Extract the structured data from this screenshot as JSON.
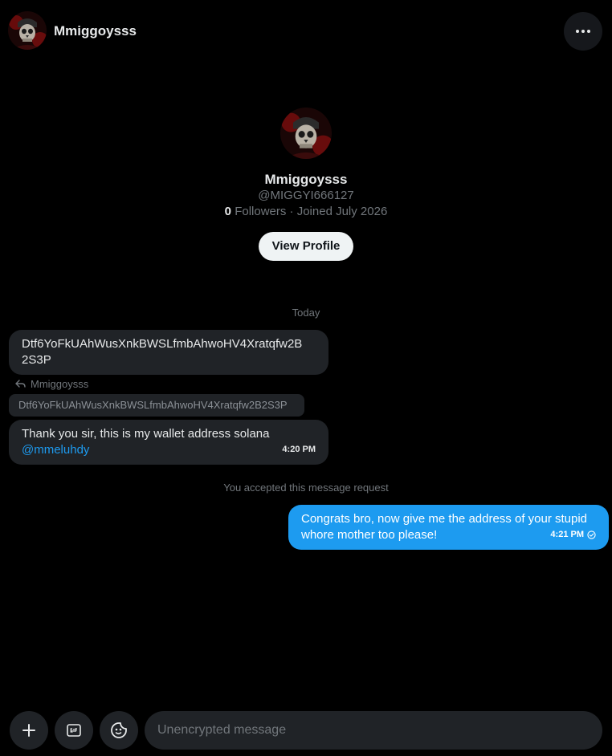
{
  "header": {
    "name": "Mmiggoysss",
    "avatar_icon": "skull-avatar-icon",
    "more_icon": "more-horizontal-icon"
  },
  "profile": {
    "name": "Mmiggoysss",
    "handle": "@MIGGYI666127",
    "followers_count": "0",
    "followers_label": "Followers",
    "meta_separator": " · ",
    "joined": "Joined July 2026",
    "view_profile_label": "View Profile"
  },
  "conversation": {
    "date_divider": "Today",
    "messages": [
      {
        "direction": "incoming",
        "text_line1": "Dtf6YoFkUAhWusXnkBWSLfmbAhwoHV4Xratqfw2B",
        "text_line2": "2S3P"
      },
      {
        "direction": "incoming",
        "reply_to_name": "Mmiggoysss",
        "quoted_text": "Dtf6YoFkUAhWusXnkBWSLfmbAhwoHV4Xratqfw2B2S3P",
        "text": "Thank you sir, this is my wallet address solana",
        "mention": "@mmeluhdy",
        "time": "4:20 PM"
      },
      {
        "direction": "outgoing",
        "text_line1": "Congrats bro, now give me the address of your stupid",
        "text_line2": "whore mother too please!",
        "time": "4:21 PM",
        "status_icon": "sent-check-icon"
      }
    ],
    "accepted_notice": "You accepted this message request"
  },
  "composer": {
    "placeholder": "Unencrypted message",
    "buttons": [
      "plus-icon",
      "gif-icon",
      "emoji-icon"
    ]
  },
  "colors": {
    "background": "#000000",
    "bubble_incoming": "#202327",
    "bubble_outgoing": "#1d9bf0",
    "muted_text": "#71767b",
    "link": "#1d9bf0"
  }
}
